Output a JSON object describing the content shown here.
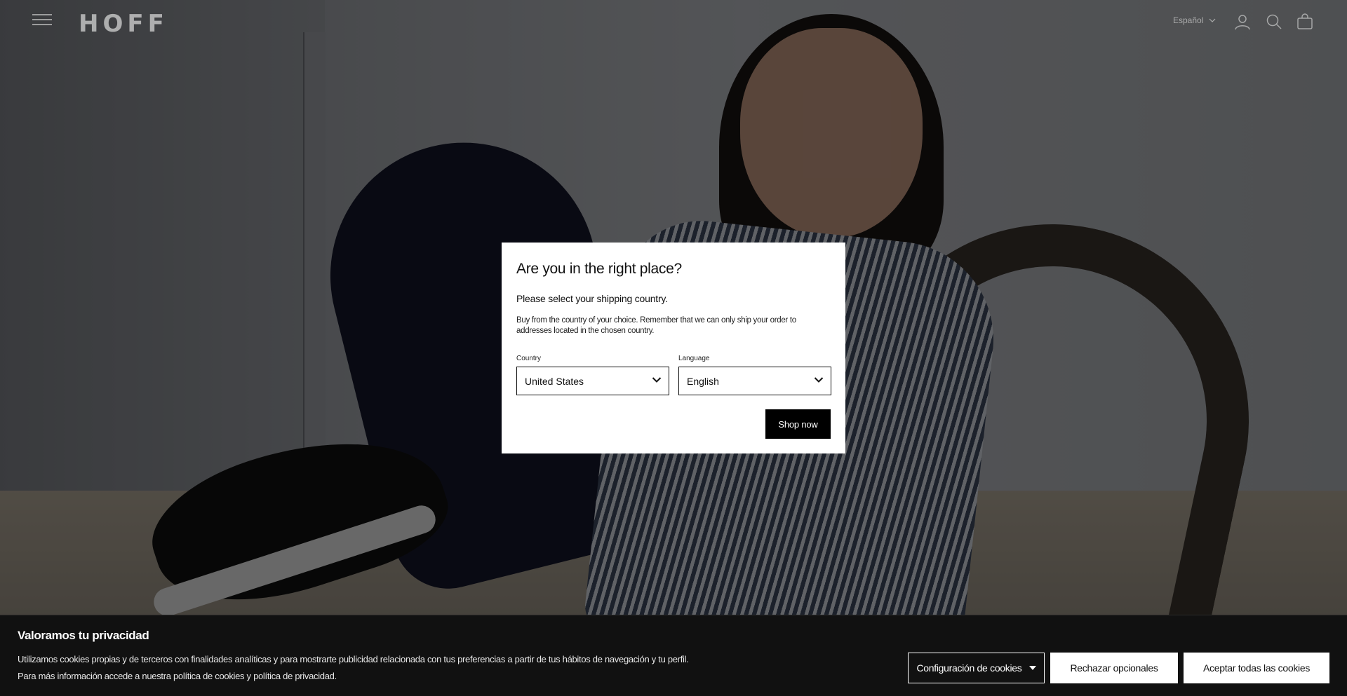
{
  "header": {
    "logo": "HOFF",
    "language_label": "Español",
    "icons": [
      "menu-icon",
      "user-icon",
      "search-icon",
      "bag-icon"
    ]
  },
  "modal": {
    "title": "Are you in the right place?",
    "subtitle": "Please select your shipping country.",
    "description": "Buy from the country of your choice. Remember that we can only ship your order to addresses located in the chosen country.",
    "country_label": "Country",
    "country_value": "United States",
    "language_label": "Language",
    "language_value": "English",
    "shop_button": "Shop now"
  },
  "cookie_banner": {
    "title": "Valoramos tu privacidad",
    "text_line1": "Utilizamos cookies propias y de terceros con finalidades analíticas y para mostrarte publicidad relacionada con tus preferencias a partir de tus hábitos de navegación y tu perfil.",
    "text_line2": "Para más información accede a nuestra política de cookies y política de privacidad.",
    "config_button": "Configuración de cookies",
    "reject_button": "Rechazar opcionales",
    "accept_button": "Aceptar todas las cookies"
  },
  "colors": {
    "modal_bg": "#ffffff",
    "primary_button": "#000000",
    "banner_bg": "#111111"
  }
}
